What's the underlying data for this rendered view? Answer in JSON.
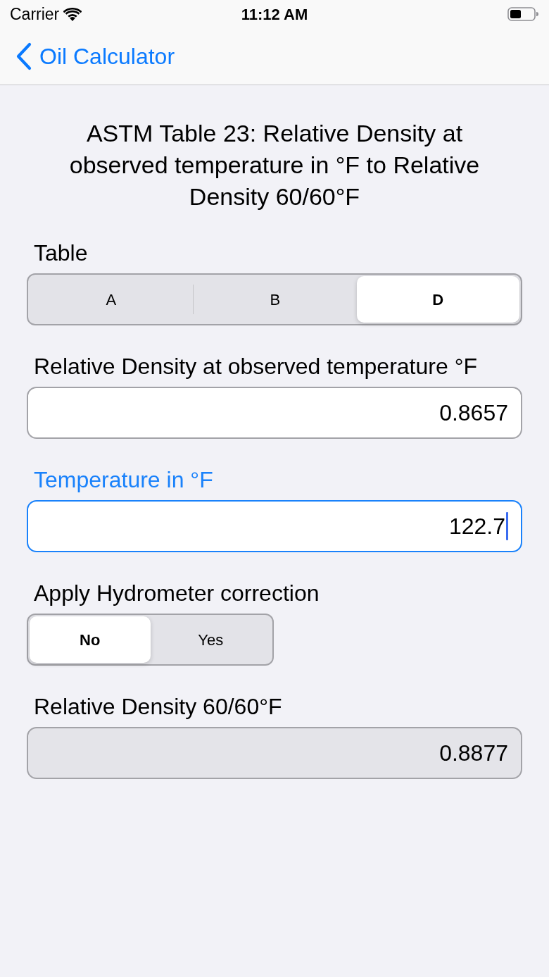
{
  "status_bar": {
    "carrier": "Carrier",
    "time": "11:12 AM"
  },
  "nav_bar": {
    "back_label": "Oil Calculator"
  },
  "title": "ASTM Table 23: Relative Density at observed temperature in °F to Relative Density 60/60°F",
  "form": [
    {
      "kind": "segmented",
      "label": "Table",
      "options": [
        {
          "label": "A",
          "selected": false
        },
        {
          "label": "B",
          "selected": false
        },
        {
          "label": "D",
          "selected": true
        }
      ]
    },
    {
      "kind": "input",
      "label": "Relative Density at observed temperature °F",
      "value": "0.8657",
      "focused": false
    },
    {
      "kind": "input",
      "label": "Temperature in °F",
      "value": "122.7",
      "focused": true
    },
    {
      "kind": "segmented",
      "label": "Apply Hydrometer correction",
      "options": [
        {
          "label": "No",
          "selected": true
        },
        {
          "label": "Yes",
          "selected": false
        }
      ]
    },
    {
      "kind": "output",
      "label": "Relative Density 60/60°F",
      "value": "0.8877"
    }
  ]
}
